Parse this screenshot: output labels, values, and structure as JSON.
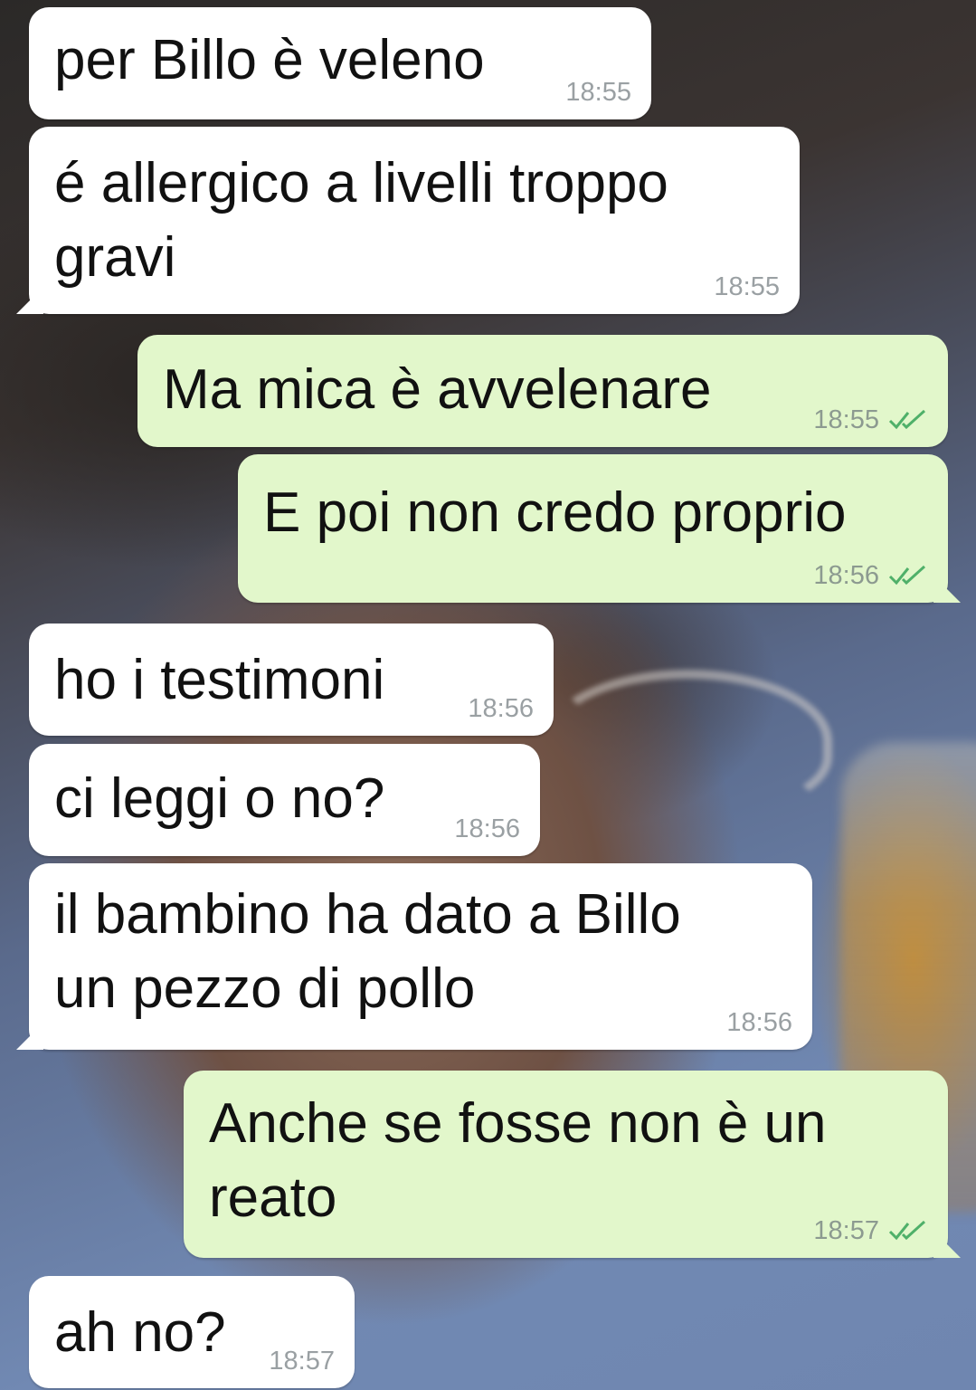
{
  "messages": [
    {
      "text": "per Billo è veleno",
      "time": "18:55"
    },
    {
      "text": "é allergico a livelli troppo\ngravi",
      "time": "18:55"
    },
    {
      "text": "Ma mica è avvelenare",
      "time": "18:55",
      "status": "read"
    },
    {
      "text": "E poi non credo proprio",
      "time": "18:56",
      "status": "read"
    },
    {
      "text": "ho i testimoni",
      "time": "18:56"
    },
    {
      "text": "ci leggi o no?",
      "time": "18:56"
    },
    {
      "text": "il bambino ha dato a Billo\nun pezzo di pollo",
      "time": "18:56"
    },
    {
      "text": "Anche se fosse non è un\nreato",
      "time": "18:57",
      "status": "read"
    },
    {
      "text": "ah no?",
      "time": "18:57"
    }
  ],
  "colors": {
    "incoming_bubble": "#ffffff",
    "outgoing_bubble": "#e2f7cb",
    "read_check": "#4fb069"
  },
  "icons": {
    "read_status": "double-check-icon"
  }
}
